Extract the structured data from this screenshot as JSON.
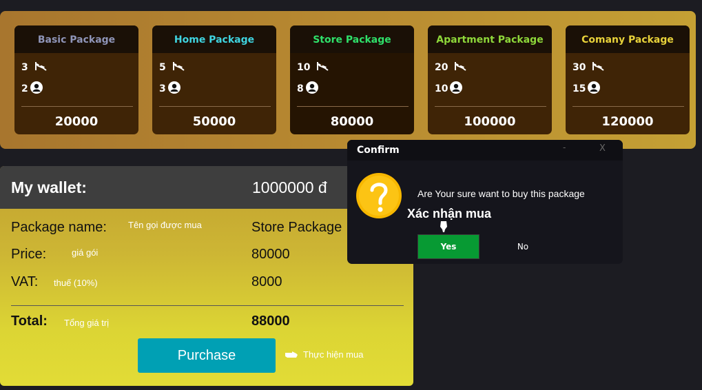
{
  "packages": [
    {
      "name": "Basic Package",
      "color": "#8f95b8",
      "cameras": "3",
      "users": "2",
      "price": "20000"
    },
    {
      "name": "Home Package",
      "color": "#3fd4e0",
      "cameras": "5",
      "users": "3",
      "price": "50000"
    },
    {
      "name": "Store Package",
      "color": "#2fe06a",
      "cameras": "10",
      "users": "8",
      "price": "80000"
    },
    {
      "name": "Apartment Package",
      "color": "#8ed83a",
      "cameras": "20",
      "users": "10",
      "price": "100000"
    },
    {
      "name": "Comany Package",
      "color": "#e8d23a",
      "cameras": "30",
      "users": "15",
      "price": "120000"
    }
  ],
  "wallet": {
    "label": "My wallet:",
    "balance": "1000000  đ",
    "rows": [
      {
        "label": "Package name:",
        "note": "Tên gọi được mua",
        "value": "Store Package"
      },
      {
        "label": "Price:",
        "note": "giá gói",
        "value": "80000"
      },
      {
        "label": "VAT:",
        "note": "thuế (10%)",
        "value": "8000"
      }
    ],
    "total_label": "Total:",
    "total_note": "Tổng giá trị",
    "total_value": "88000",
    "purchase_label": "Purchase",
    "purchase_note": "Thực hiện mua"
  },
  "dialog": {
    "title": "Confirm",
    "minimize": "-",
    "close": "X",
    "message": "Are Your sure want to buy this package",
    "annotation": "Xác nhận mua",
    "yes_label": "Yes",
    "no_label": "No"
  },
  "colors": {
    "accent": "#00a0b4",
    "yes": "#079a33"
  }
}
